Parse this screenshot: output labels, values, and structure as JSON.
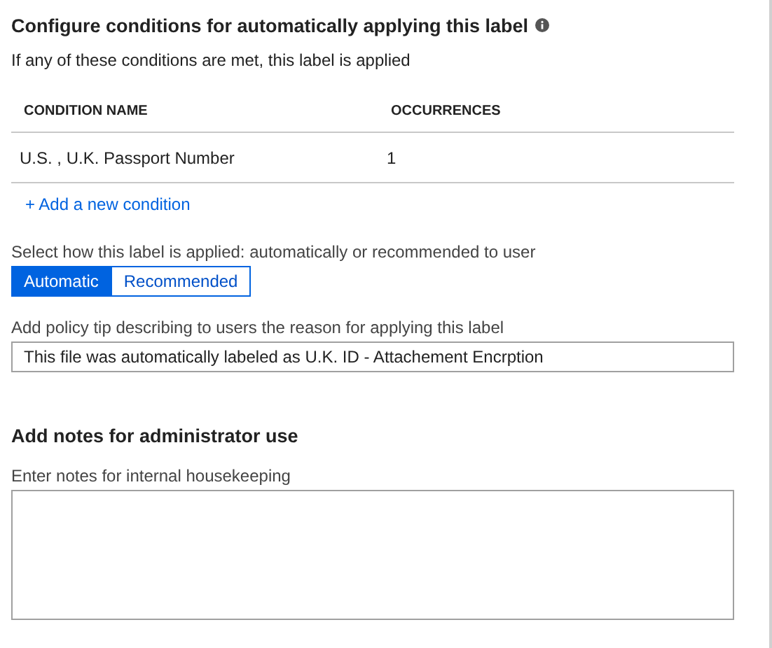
{
  "heading": "Configure conditions for automatically applying this label",
  "subtitle": "If any of these conditions are met, this label is applied",
  "table": {
    "columns": [
      "CONDITION NAME",
      "OCCURRENCES"
    ],
    "rows": [
      [
        "U.S. , U.K. Passport Number",
        "1"
      ]
    ]
  },
  "add_condition": "+ Add a new condition",
  "mode": {
    "label": "Select how this label is applied: automatically or recommended to user",
    "options": [
      {
        "label": "Automatic",
        "selected": true
      },
      {
        "label": "Recommended",
        "selected": false
      }
    ]
  },
  "policy_tip": {
    "label": "Add policy tip describing to users the reason for applying this label",
    "value": "This file was automatically labeled as U.K. ID - Attachement Encrption"
  },
  "notes": {
    "heading": "Add notes for administrator use",
    "label": "Enter notes for internal housekeeping"
  }
}
